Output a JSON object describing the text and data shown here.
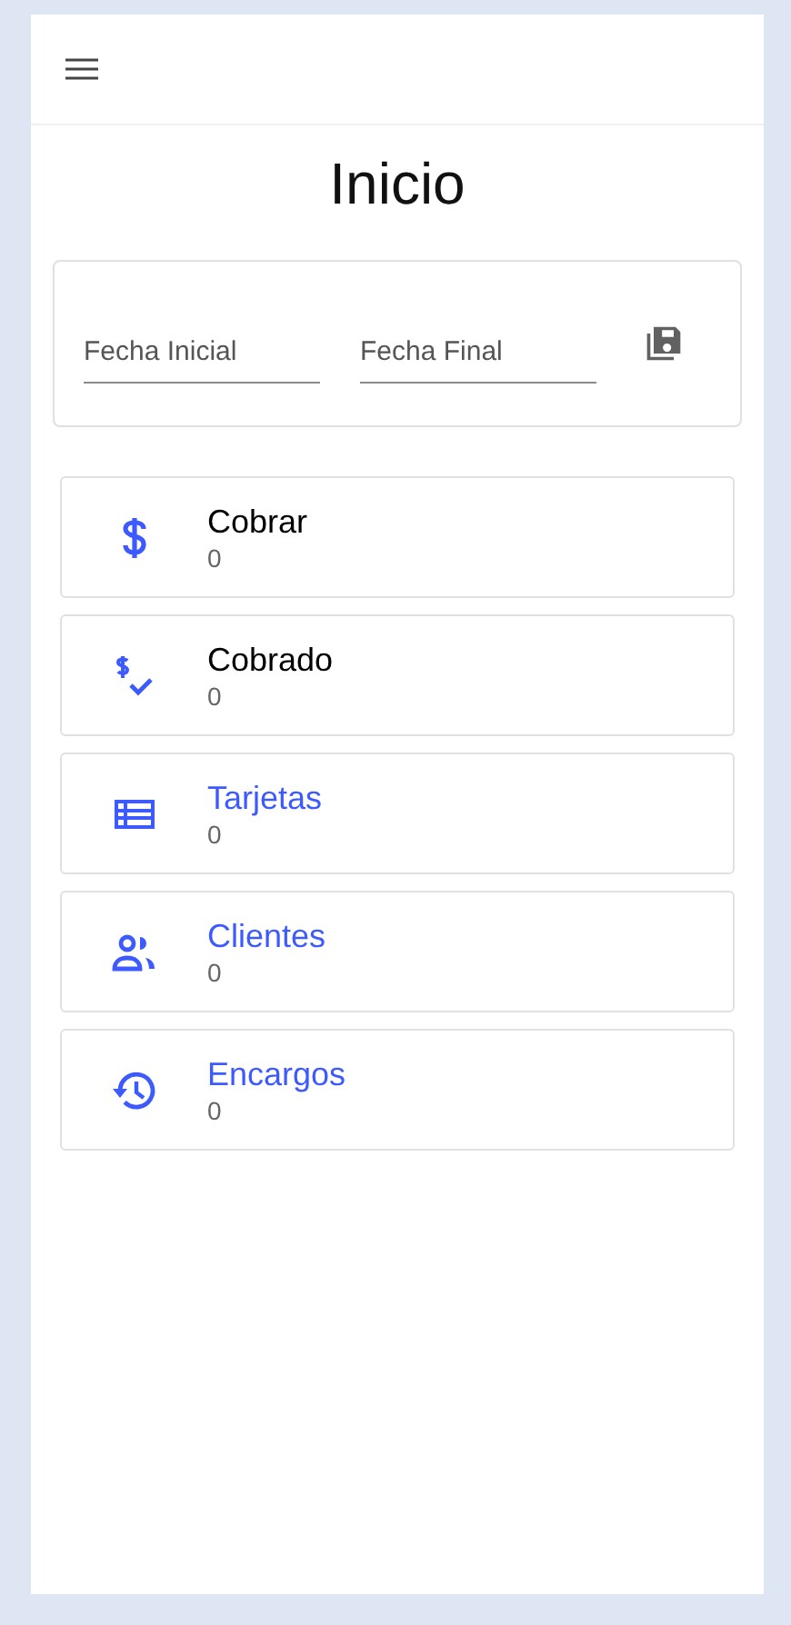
{
  "page_title": "Inicio",
  "filters": {
    "start_date": {
      "placeholder": "Fecha Inicial"
    },
    "end_date": {
      "placeholder": "Fecha Final"
    }
  },
  "items": [
    {
      "kind": "dollar",
      "title": "Cobrar",
      "count": "0",
      "color": "#000000"
    },
    {
      "kind": "dollar-check",
      "title": "Cobrado",
      "count": "0",
      "color": "#000000"
    },
    {
      "kind": "list",
      "title": "Tarjetas",
      "count": "0",
      "color": "#3d5afe"
    },
    {
      "kind": "people",
      "title": "Clientes",
      "count": "0",
      "color": "#3d5afe"
    },
    {
      "kind": "history",
      "title": "Encargos",
      "count": "0",
      "color": "#3d5afe"
    }
  ]
}
